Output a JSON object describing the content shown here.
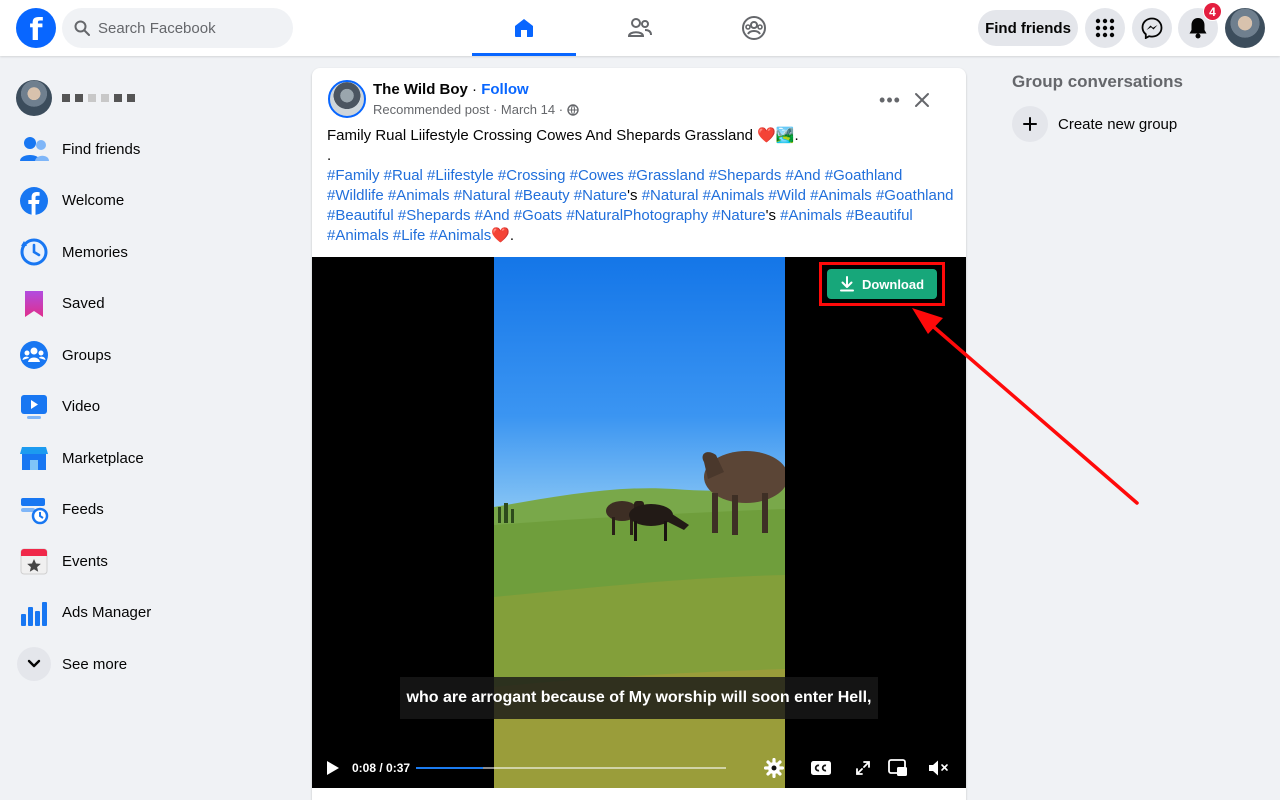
{
  "header": {
    "logo_letter": "f",
    "search_placeholder": "Search Facebook",
    "tabs": [
      "home",
      "friends",
      "groups"
    ],
    "find_friends_label": "Find friends",
    "notification_count": "4"
  },
  "sidebar": {
    "items": [
      {
        "label": "Find friends",
        "icon": "friends-icon"
      },
      {
        "label": "Welcome",
        "icon": "facebook-icon"
      },
      {
        "label": "Memories",
        "icon": "clock-icon"
      },
      {
        "label": "Saved",
        "icon": "bookmark-icon"
      },
      {
        "label": "Groups",
        "icon": "groups-icon"
      },
      {
        "label": "Video",
        "icon": "video-icon"
      },
      {
        "label": "Marketplace",
        "icon": "marketplace-icon"
      },
      {
        "label": "Feeds",
        "icon": "feeds-icon"
      },
      {
        "label": "Events",
        "icon": "events-icon"
      },
      {
        "label": "Ads Manager",
        "icon": "ads-icon"
      },
      {
        "label": "See more",
        "icon": "chevron-down-icon"
      }
    ]
  },
  "post": {
    "author": "The Wild Boy",
    "separator": " · ",
    "follow_label": "Follow",
    "meta": "Recommended post · March 14 ·",
    "title_text": "Family Rual Liifestyle Crossing Cowes And Shepards Grassland ❤️🏞️.",
    "dot_line": ".",
    "hashtags_1": "#Family #Rual #Liifestyle #Crossing #Cowes #Grassland #Shepards #And #Goathland #Wildlife #Animals #Natural #Beauty #Nature",
    "apostrophe_1": "'s",
    "hashtags_2": " #Natural #Animals #Wild #Animals #Goathland #Beautiful #Shepards #And #Goats #NaturalPhotography #Nature",
    "apostrophe_2": "'s",
    "hashtags_3": " #Animals #Beautiful #Animals #Life #Animals",
    "tail": "❤️."
  },
  "video": {
    "caption": "who are arrogant because of My worship will soon enter Hell,",
    "time": "0:08 / 0:37",
    "progress": 0.216,
    "download_label": "Download",
    "accent_color": "#17a77a"
  },
  "rightcol": {
    "title": "Group conversations",
    "create_label": "Create new group"
  }
}
